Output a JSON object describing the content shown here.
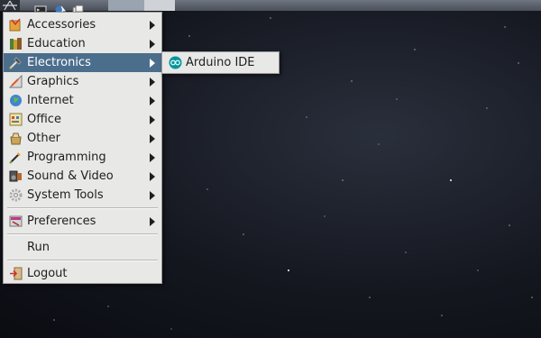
{
  "panel": {
    "icons": [
      "menu-logo-icon",
      "terminal-icon",
      "browser-icon",
      "file-manager-icon"
    ]
  },
  "menu": {
    "items": [
      {
        "label": "Accessories",
        "icon": "accessories-icon",
        "submenu": true
      },
      {
        "label": "Education",
        "icon": "education-icon",
        "submenu": true
      },
      {
        "label": "Electronics",
        "icon": "electronics-icon",
        "submenu": true,
        "selected": true
      },
      {
        "label": "Graphics",
        "icon": "graphics-icon",
        "submenu": true
      },
      {
        "label": "Internet",
        "icon": "internet-icon",
        "submenu": true
      },
      {
        "label": "Office",
        "icon": "office-icon",
        "submenu": true
      },
      {
        "label": "Other",
        "icon": "other-icon",
        "submenu": true
      },
      {
        "label": "Programming",
        "icon": "programming-icon",
        "submenu": true
      },
      {
        "label": "Sound & Video",
        "icon": "sound-video-icon",
        "submenu": true
      },
      {
        "label": "System Tools",
        "icon": "system-tools-icon",
        "submenu": true
      }
    ],
    "preferences": {
      "label": "Preferences",
      "icon": "preferences-icon"
    },
    "run": {
      "label": "Run"
    },
    "logout": {
      "label": "Logout",
      "icon": "logout-icon"
    }
  },
  "submenu": {
    "items": [
      {
        "label": "Arduino IDE",
        "icon": "arduino-icon"
      }
    ]
  },
  "colors": {
    "selection": "#4c6e8d",
    "menu_bg": "#e8e8e7",
    "arduino": "#00979c"
  }
}
